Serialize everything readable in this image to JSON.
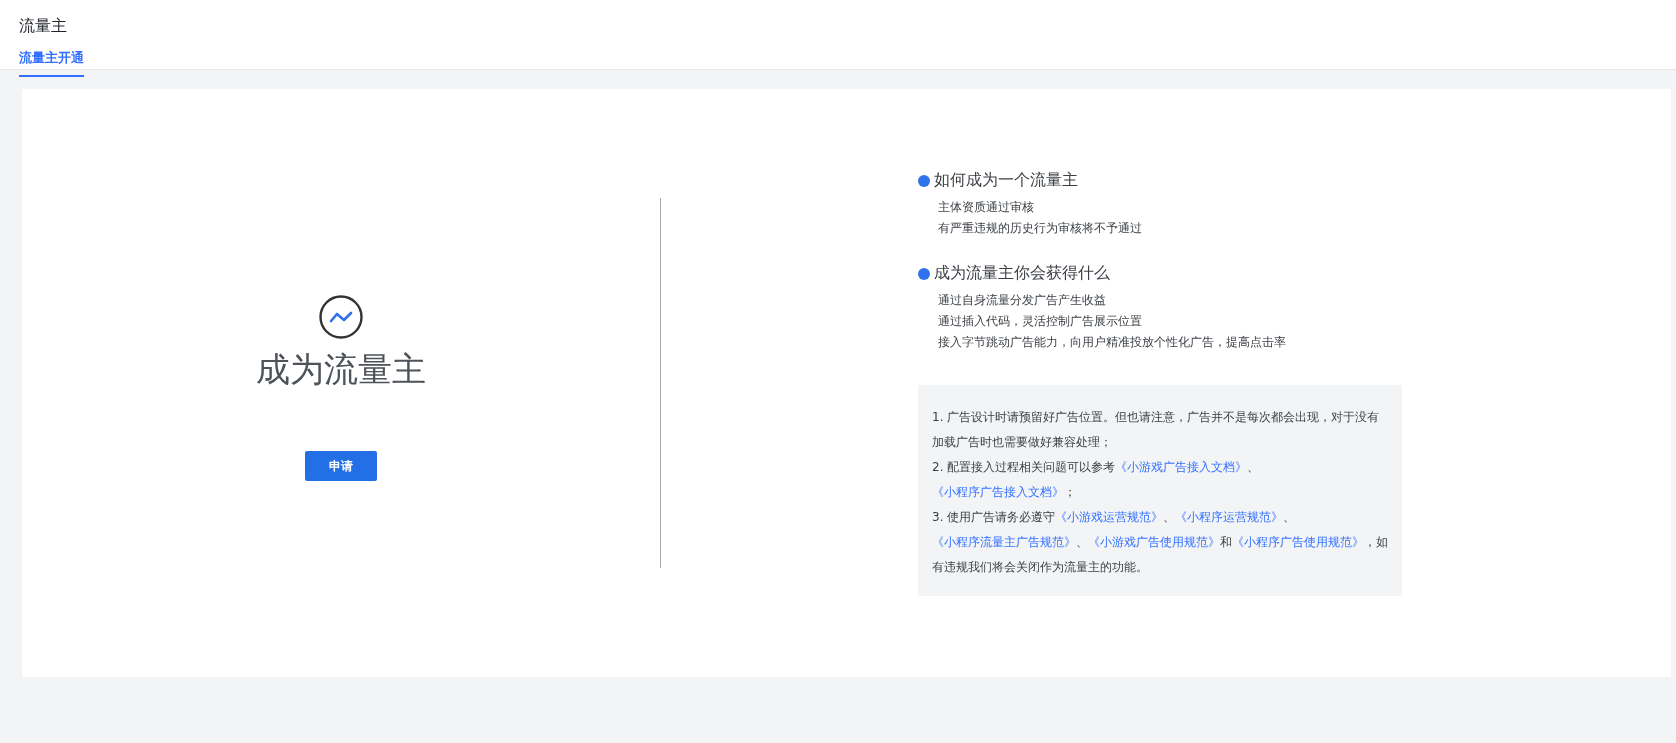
{
  "header": {
    "title": "流量主",
    "tabs": [
      {
        "label": "流量主开通",
        "selected": true
      }
    ]
  },
  "hero": {
    "title": "成为流量主",
    "button": "申请"
  },
  "sections": [
    {
      "heading": "如何成为一个流量主",
      "lines": [
        "主体资质通过审核",
        "有严重违规的历史行为审核将不予通过"
      ]
    },
    {
      "heading": "成为流量主你会获得什么",
      "lines": [
        "通过自身流量分发广告产生收益",
        "通过插入代码，灵活控制广告展示位置",
        "接入字节跳动广告能力，向用户精准投放个性化广告，提高点击率"
      ]
    }
  ],
  "notes": [
    [
      {
        "kind": "text",
        "text": "1. 广告设计时请预留好广告位置。但也请注意，广告并不是每次都会出现，对于没有加载广告时也需要做好兼容处理；"
      }
    ],
    [
      {
        "kind": "text",
        "text": "2. 配置接入过程相关问题可以参考"
      },
      {
        "kind": "link",
        "text": "《小游戏广告接入文档》"
      },
      {
        "kind": "text",
        "text": "、"
      },
      {
        "kind": "link",
        "text": "《小程序广告接入文档》"
      },
      {
        "kind": "text",
        "text": "；"
      }
    ],
    [
      {
        "kind": "text",
        "text": "3. 使用广告请务必遵守"
      },
      {
        "kind": "link",
        "text": "《小游戏运营规范》"
      },
      {
        "kind": "text",
        "text": "、"
      },
      {
        "kind": "link",
        "text": "《小程序运营规范》"
      },
      {
        "kind": "text",
        "text": "、"
      },
      {
        "kind": "link",
        "text": "《小程序流量主广告规范》"
      },
      {
        "kind": "text",
        "text": "、"
      },
      {
        "kind": "link",
        "text": "《小游戏广告使用规范》"
      },
      {
        "kind": "text",
        "text": "和"
      },
      {
        "kind": "link",
        "text": "《小程序广告使用规范》"
      },
      {
        "kind": "text",
        "text": "，如有违规我们将会关闭作为流量主的功能。"
      }
    ]
  ]
}
